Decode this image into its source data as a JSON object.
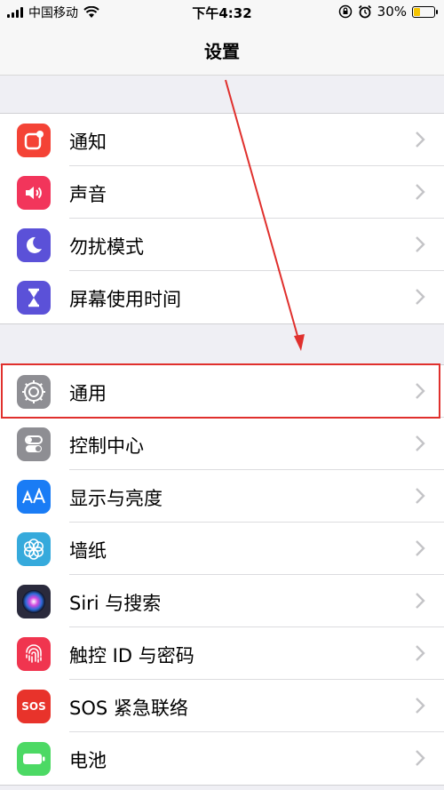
{
  "status_bar": {
    "carrier": "中国移动",
    "time": "下午4:32",
    "battery_pct": "30%",
    "battery_level": 0.3
  },
  "nav": {
    "title": "设置"
  },
  "groups": [
    {
      "items": [
        {
          "label": "通知",
          "icon": "notifications-icon",
          "color": "#f44336"
        },
        {
          "label": "声音",
          "icon": "sounds-icon",
          "color": "#f2355b"
        },
        {
          "label": "勿扰模式",
          "icon": "do-not-disturb-moon-icon",
          "color": "#5b51d8"
        },
        {
          "label": "屏幕使用时间",
          "icon": "screen-time-hourglass-icon",
          "color": "#5b51d8"
        }
      ]
    },
    {
      "items": [
        {
          "label": "通用",
          "icon": "general-gear-icon",
          "color": "#8e8e93"
        },
        {
          "label": "控制中心",
          "icon": "control-center-toggles-icon",
          "color": "#8e8e93"
        },
        {
          "label": "显示与亮度",
          "icon": "display-brightness-aa-icon",
          "color": "#1a7cf5"
        },
        {
          "label": "墙纸",
          "icon": "wallpaper-flower-icon",
          "color": "#36aadc"
        },
        {
          "label": "Siri 与搜索",
          "icon": "siri-icon",
          "color": "#2a2a3c"
        },
        {
          "label": "触控 ID 与密码",
          "icon": "touch-id-fingerprint-icon",
          "color": "#f0354f"
        },
        {
          "label": "SOS 紧急联络",
          "icon": "sos-icon",
          "color": "#e8332b",
          "icon_text": "SOS"
        },
        {
          "label": "电池",
          "icon": "battery-icon",
          "color": "#4cd964"
        }
      ]
    }
  ],
  "colors": {
    "annotation": "#e0302d",
    "background": "#efeff4"
  }
}
